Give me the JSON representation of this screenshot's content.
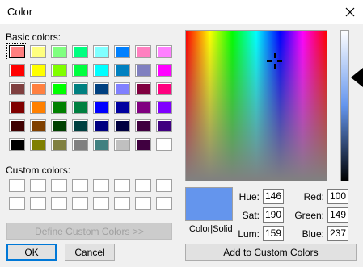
{
  "window": {
    "title": "Color"
  },
  "basic_colors": {
    "label": "Basic colors:",
    "rows": [
      [
        "#ff8080",
        "#ffff80",
        "#80ff80",
        "#00ff80",
        "#80ffff",
        "#0080ff",
        "#ff80c0",
        "#ff80ff"
      ],
      [
        "#ff0000",
        "#ffff00",
        "#80ff00",
        "#00ff40",
        "#00ffff",
        "#0080c0",
        "#8080c0",
        "#ff00ff"
      ],
      [
        "#804040",
        "#ff8040",
        "#00ff00",
        "#008080",
        "#004080",
        "#8080ff",
        "#800040",
        "#ff0080"
      ],
      [
        "#800000",
        "#ff8000",
        "#008000",
        "#008040",
        "#0000ff",
        "#0000a0",
        "#800080",
        "#8000ff"
      ],
      [
        "#400000",
        "#804000",
        "#004000",
        "#004040",
        "#000080",
        "#000040",
        "#400040",
        "#400080"
      ],
      [
        "#000000",
        "#808000",
        "#808040",
        "#808080",
        "#408080",
        "#c0c0c0",
        "#400040",
        "#ffffff"
      ]
    ]
  },
  "custom_colors": {
    "label": "Custom colors:"
  },
  "buttons": {
    "define_custom": "Define Custom Colors >>",
    "ok": "OK",
    "cancel": "Cancel",
    "add_custom": "Add to Custom Colors"
  },
  "preview": {
    "label": "Color|Solid",
    "color": "#6495ed"
  },
  "fields": {
    "hue_label": "Hue:",
    "hue": "146",
    "sat_label": "Sat:",
    "sat": "190",
    "lum_label": "Lum:",
    "lum": "159",
    "red_label": "Red:",
    "red": "100",
    "green_label": "Green:",
    "green": "149",
    "blue_label": "Blue:",
    "blue": "237"
  }
}
